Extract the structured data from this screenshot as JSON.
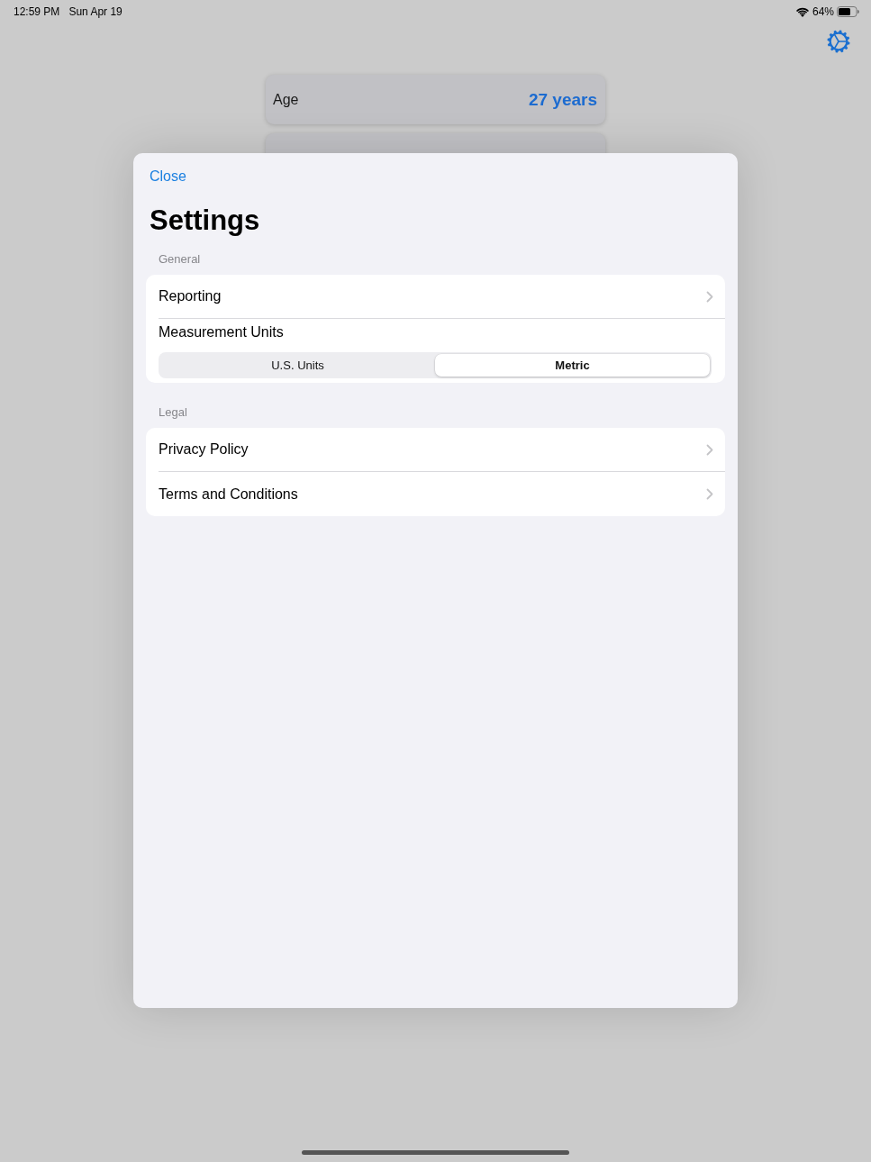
{
  "status_bar": {
    "time": "12:59 PM",
    "date": "Sun Apr 19",
    "battery": "64%"
  },
  "background_cards": [
    {
      "label": "Age",
      "value": "27 years"
    }
  ],
  "settings_sheet": {
    "close": "Close",
    "title": "Settings",
    "sections": [
      {
        "header": "General",
        "rows": [
          {
            "kind": "link",
            "label": "Reporting"
          },
          {
            "kind": "segmented",
            "label": "Measurement Units",
            "options": [
              {
                "label": "U.S. Units",
                "selected": false
              },
              {
                "label": "Metric",
                "selected": true
              }
            ]
          }
        ]
      },
      {
        "header": "Legal",
        "rows": [
          {
            "kind": "link",
            "label": "Privacy Policy"
          },
          {
            "kind": "link",
            "label": "Terms and Conditions"
          }
        ]
      }
    ]
  }
}
